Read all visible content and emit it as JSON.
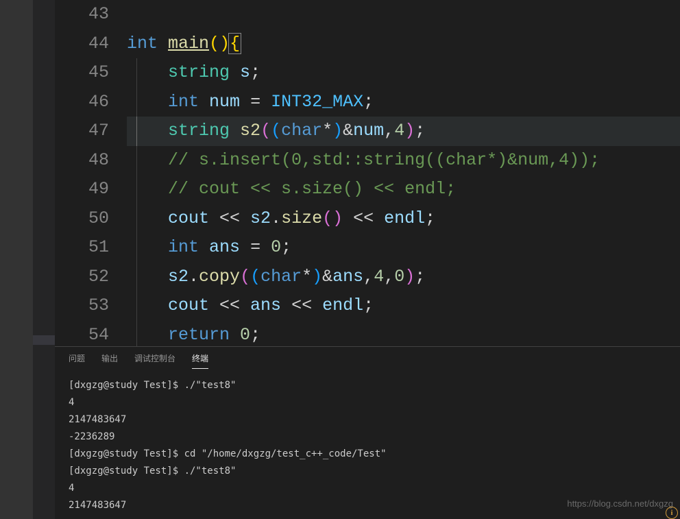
{
  "editor": {
    "lines": [
      {
        "num": 43,
        "tokens": []
      },
      {
        "num": 44,
        "tokens": [
          {
            "t": "int",
            "c": "tok-keyword"
          },
          {
            "t": " ",
            "c": ""
          },
          {
            "t": "main",
            "c": "tok-func-u"
          },
          {
            "t": "(",
            "c": "tok-bracket-y"
          },
          {
            "t": ")",
            "c": "tok-bracket-y"
          },
          {
            "t": "{",
            "c": "tok-bracket-y bracket-match"
          }
        ]
      },
      {
        "num": 45,
        "indent": 1,
        "tokens": [
          {
            "t": "    ",
            "c": ""
          },
          {
            "t": "string",
            "c": "tok-type"
          },
          {
            "t": " ",
            "c": ""
          },
          {
            "t": "s",
            "c": "tok-var"
          },
          {
            "t": ";",
            "c": "tok-punct"
          }
        ]
      },
      {
        "num": 46,
        "indent": 1,
        "tokens": [
          {
            "t": "    ",
            "c": ""
          },
          {
            "t": "int",
            "c": "tok-keyword"
          },
          {
            "t": " ",
            "c": ""
          },
          {
            "t": "num",
            "c": "tok-var"
          },
          {
            "t": " = ",
            "c": "tok-op"
          },
          {
            "t": "INT32_MAX",
            "c": "tok-const"
          },
          {
            "t": ";",
            "c": "tok-punct"
          }
        ]
      },
      {
        "num": 47,
        "indent": 1,
        "highlight": true,
        "tokens": [
          {
            "t": "    ",
            "c": ""
          },
          {
            "t": "string",
            "c": "tok-type"
          },
          {
            "t": " ",
            "c": ""
          },
          {
            "t": "s2",
            "c": "tok-func"
          },
          {
            "t": "(",
            "c": "tok-bracket-p"
          },
          {
            "t": "(",
            "c": "tok-bracket-b"
          },
          {
            "t": "char",
            "c": "tok-keyword"
          },
          {
            "t": "*",
            "c": "tok-op"
          },
          {
            "t": ")",
            "c": "tok-bracket-b"
          },
          {
            "t": "&",
            "c": "tok-op"
          },
          {
            "t": "num",
            "c": "tok-var"
          },
          {
            "t": ",",
            "c": "tok-punct"
          },
          {
            "t": "4",
            "c": "tok-number"
          },
          {
            "t": ")",
            "c": "tok-bracket-p"
          },
          {
            "t": ";",
            "c": "tok-punct"
          }
        ]
      },
      {
        "num": 48,
        "indent": 1,
        "tokens": [
          {
            "t": "    ",
            "c": ""
          },
          {
            "t": "// s.insert(0,std::string((char*)&num,4));",
            "c": "tok-comment"
          }
        ]
      },
      {
        "num": 49,
        "indent": 1,
        "tokens": [
          {
            "t": "    ",
            "c": ""
          },
          {
            "t": "// cout << s.size() << endl;",
            "c": "tok-comment"
          }
        ]
      },
      {
        "num": 50,
        "indent": 1,
        "tokens": [
          {
            "t": "    ",
            "c": ""
          },
          {
            "t": "cout",
            "c": "tok-var"
          },
          {
            "t": " << ",
            "c": "tok-op"
          },
          {
            "t": "s2",
            "c": "tok-var"
          },
          {
            "t": ".",
            "c": "tok-punct"
          },
          {
            "t": "size",
            "c": "tok-func"
          },
          {
            "t": "(",
            "c": "tok-bracket-p"
          },
          {
            "t": ")",
            "c": "tok-bracket-p"
          },
          {
            "t": " << ",
            "c": "tok-op"
          },
          {
            "t": "endl",
            "c": "tok-var"
          },
          {
            "t": ";",
            "c": "tok-punct"
          }
        ]
      },
      {
        "num": 51,
        "indent": 1,
        "tokens": [
          {
            "t": "    ",
            "c": ""
          },
          {
            "t": "int",
            "c": "tok-keyword"
          },
          {
            "t": " ",
            "c": ""
          },
          {
            "t": "ans",
            "c": "tok-var"
          },
          {
            "t": " = ",
            "c": "tok-op"
          },
          {
            "t": "0",
            "c": "tok-number"
          },
          {
            "t": ";",
            "c": "tok-punct"
          }
        ]
      },
      {
        "num": 52,
        "indent": 1,
        "tokens": [
          {
            "t": "    ",
            "c": ""
          },
          {
            "t": "s2",
            "c": "tok-var"
          },
          {
            "t": ".",
            "c": "tok-punct"
          },
          {
            "t": "copy",
            "c": "tok-func"
          },
          {
            "t": "(",
            "c": "tok-bracket-p"
          },
          {
            "t": "(",
            "c": "tok-bracket-b"
          },
          {
            "t": "char",
            "c": "tok-keyword"
          },
          {
            "t": "*",
            "c": "tok-op"
          },
          {
            "t": ")",
            "c": "tok-bracket-b"
          },
          {
            "t": "&",
            "c": "tok-op"
          },
          {
            "t": "ans",
            "c": "tok-var"
          },
          {
            "t": ",",
            "c": "tok-punct"
          },
          {
            "t": "4",
            "c": "tok-number"
          },
          {
            "t": ",",
            "c": "tok-punct"
          },
          {
            "t": "0",
            "c": "tok-number"
          },
          {
            "t": ")",
            "c": "tok-bracket-p"
          },
          {
            "t": ";",
            "c": "tok-punct"
          }
        ]
      },
      {
        "num": 53,
        "indent": 1,
        "tokens": [
          {
            "t": "    ",
            "c": ""
          },
          {
            "t": "cout",
            "c": "tok-var"
          },
          {
            "t": " << ",
            "c": "tok-op"
          },
          {
            "t": "ans",
            "c": "tok-var"
          },
          {
            "t": " << ",
            "c": "tok-op"
          },
          {
            "t": "endl",
            "c": "tok-var"
          },
          {
            "t": ";",
            "c": "tok-punct"
          }
        ]
      },
      {
        "num": 54,
        "indent": 1,
        "tokens": [
          {
            "t": "    ",
            "c": ""
          },
          {
            "t": "return",
            "c": "tok-keyword"
          },
          {
            "t": " ",
            "c": ""
          },
          {
            "t": "0",
            "c": "tok-number"
          },
          {
            "t": ";",
            "c": "tok-punct"
          }
        ]
      }
    ]
  },
  "panel": {
    "tabs": [
      {
        "label": "问题",
        "active": false
      },
      {
        "label": "输出",
        "active": false
      },
      {
        "label": "调试控制台",
        "active": false
      },
      {
        "label": "终端",
        "active": true
      }
    ],
    "terminal_lines": [
      "[dxgzg@study Test]$ ./\"test8\"",
      "4",
      "2147483647",
      "-2236289",
      "[dxgzg@study Test]$ cd \"/home/dxgzg/test_c++_code/Test\"",
      "[dxgzg@study Test]$ ./\"test8\"",
      "4",
      "2147483647"
    ]
  },
  "watermark": "https://blog.csdn.net/dxgzg"
}
